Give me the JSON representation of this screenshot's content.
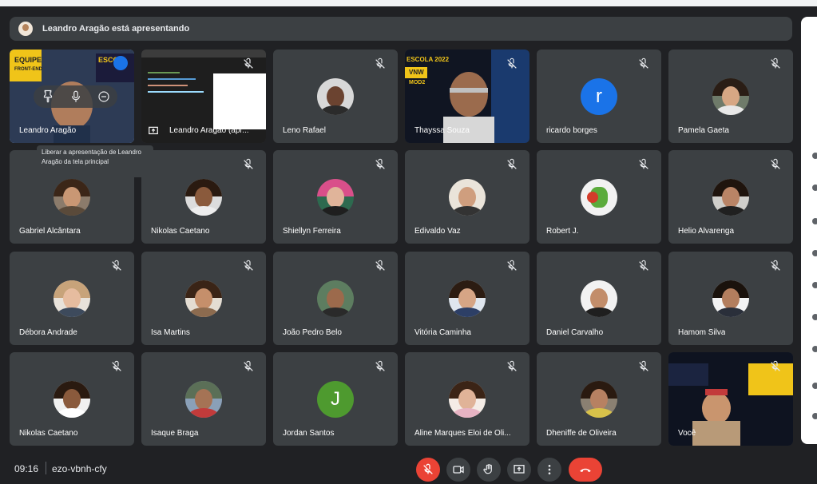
{
  "banner": {
    "text": "Leandro Aragão está apresentando"
  },
  "tooltip": {
    "text": "Liberar a apresentação de Leandro Aragão da tela principal"
  },
  "tiles": [
    {
      "name": "Leandro Aragão"
    },
    {
      "name": "Leandro Aragão (apr..."
    },
    {
      "name": "Leno Rafael"
    },
    {
      "name": "Thayssa Souza"
    },
    {
      "name": "ricardo borges",
      "letter": "r"
    },
    {
      "name": "Pamela Gaeta"
    },
    {
      "name": "Gabriel Alcântara"
    },
    {
      "name": "Nikolas Caetano"
    },
    {
      "name": "Shiellyn Ferreira"
    },
    {
      "name": "Edivaldo Vaz"
    },
    {
      "name": "Robert J."
    },
    {
      "name": "Helio Alvarenga"
    },
    {
      "name": "Débora Andrade"
    },
    {
      "name": "Isa Martins"
    },
    {
      "name": "João Pedro Belo"
    },
    {
      "name": "Vitória Caminha"
    },
    {
      "name": "Daniel Carvalho"
    },
    {
      "name": "Hamom Silva"
    },
    {
      "name": "Nikolas Caetano"
    },
    {
      "name": "Isaque Braga"
    },
    {
      "name": "Jordan Santos",
      "letter": "J"
    },
    {
      "name": "Aline Marques Eloi de Oli..."
    },
    {
      "name": "Dheniffe de Oliveira"
    },
    {
      "name": "Você"
    }
  ],
  "tile_overlays": {
    "equipe_label": "EQUIPE",
    "front_end_label": "FRONT-END",
    "escola_label": "ESCOLA 2022",
    "vnw_label": "VNW",
    "modulo_label": "MOD2",
    "esco_partial": "ESCO"
  },
  "footer": {
    "time": "09:16",
    "separator": "|",
    "meeting_code": "ezo-vbnh-cfy"
  },
  "colors": {
    "background": "#202124",
    "tile": "#3c4043",
    "accent_blue": "#8ab4f8",
    "red": "#ea4335",
    "ricardo_avatar": "#1a73e8",
    "jordan_avatar": "#4e9a2f"
  }
}
